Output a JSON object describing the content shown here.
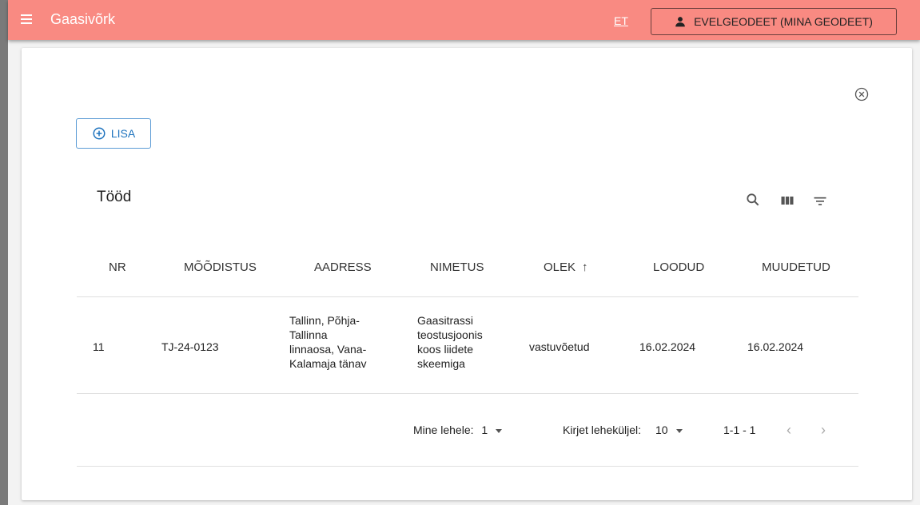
{
  "app": {
    "title": "Gaasivõrk"
  },
  "header": {
    "language": "ET",
    "user_label": "EVELGEODEET (MINA GEODEET)"
  },
  "toolbar": {
    "add_label": "LISA"
  },
  "table": {
    "title": "Tööd",
    "columns": [
      "NR",
      "MÕÕDISTUS",
      "AADRESS",
      "NIMETUS",
      "OLEK",
      "LOODUD",
      "MUUDETUD"
    ],
    "sort_indicator": "↑",
    "rows": [
      {
        "nr": "11",
        "moodistus": "TJ-24-0123",
        "aadress": [
          "Tallinn, Põhja-",
          "Tallinna",
          "linnaosa, Vana-",
          "Kalamaja tänav"
        ],
        "nimetus": [
          "Gaasitrassi",
          "teostusjoonis",
          "koos liidete",
          "skeemiga"
        ],
        "olek": "vastuvõetud",
        "loodud": "16.02.2024",
        "muudetud": "16.02.2024"
      }
    ]
  },
  "pagination": {
    "goto_label": "Mine lehele:",
    "goto_value": "1",
    "rows_label": "Kirjet leheküljel:",
    "rows_value": "10",
    "range": "1-1 - 1"
  },
  "icons": [
    "menu-icon",
    "person-icon",
    "close-icon",
    "add-circle-icon",
    "search-icon",
    "columns-icon",
    "filter-icon",
    "chevron-left-icon",
    "chevron-right-icon"
  ],
  "colors": {
    "topbar": "#f98a82",
    "accent": "#1e73be"
  }
}
